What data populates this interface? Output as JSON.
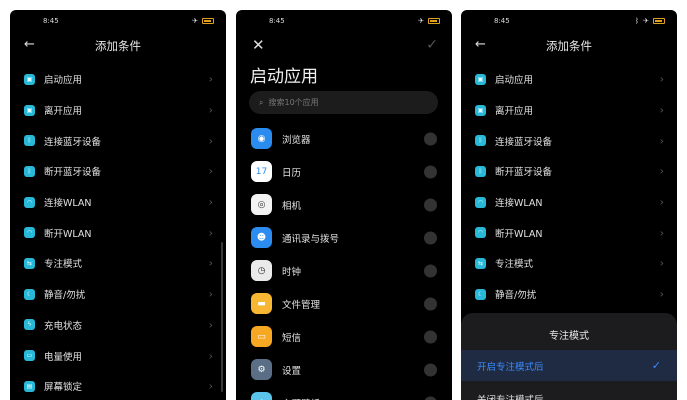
{
  "status": {
    "time": "8:45",
    "airplane": "✈"
  },
  "panel1": {
    "back": "←",
    "title": "添加条件",
    "items": [
      {
        "label": "启动应用",
        "icon": "app-launch-icon",
        "glyph": "▣"
      },
      {
        "label": "离开应用",
        "icon": "app-leave-icon",
        "glyph": "▣"
      },
      {
        "label": "连接蓝牙设备",
        "icon": "bluetooth-connect-icon",
        "glyph": "ᛒ"
      },
      {
        "label": "断开蓝牙设备",
        "icon": "bluetooth-disconnect-icon",
        "glyph": "ᛒ"
      },
      {
        "label": "连接WLAN",
        "icon": "wlan-connect-icon",
        "glyph": "◠"
      },
      {
        "label": "断开WLAN",
        "icon": "wlan-disconnect-icon",
        "glyph": "◠"
      },
      {
        "label": "专注模式",
        "icon": "focus-mode-icon",
        "glyph": "⇆"
      },
      {
        "label": "静音/勿扰",
        "icon": "silent-icon",
        "glyph": "☾"
      },
      {
        "label": "充电状态",
        "icon": "charging-icon",
        "glyph": "ϟ"
      },
      {
        "label": "电量使用",
        "icon": "battery-usage-icon",
        "glyph": "▭"
      },
      {
        "label": "屏幕锁定",
        "icon": "screen-lock-icon",
        "glyph": "▤"
      }
    ]
  },
  "panel2": {
    "close": "✕",
    "confirm": "✓",
    "title": "启动应用",
    "search_placeholder": "搜索10个应用",
    "apps": [
      {
        "label": "浏览器",
        "icon": "browser-icon",
        "color": "#2b8cf0",
        "glyph": "◉"
      },
      {
        "label": "日历",
        "icon": "calendar-icon",
        "color": "#ffffff",
        "glyph": "17"
      },
      {
        "label": "相机",
        "icon": "camera-icon",
        "color": "#f2f2f2",
        "glyph": "◎"
      },
      {
        "label": "通讯录与拨号",
        "icon": "contacts-icon",
        "color": "#2d8cf0",
        "glyph": "☻"
      },
      {
        "label": "时钟",
        "icon": "clock-icon",
        "color": "#eaeaea",
        "glyph": "◷"
      },
      {
        "label": "文件管理",
        "icon": "file-manager-icon",
        "color": "#f7b733",
        "glyph": "▬"
      },
      {
        "label": "短信",
        "icon": "messages-icon",
        "color": "#f7a823",
        "glyph": "▭"
      },
      {
        "label": "设置",
        "icon": "settings-icon",
        "color": "#5a6f86",
        "glyph": "⚙"
      },
      {
        "label": "主题壁纸",
        "icon": "theme-icon",
        "color": "#5bc4ea",
        "glyph": "◆"
      }
    ]
  },
  "panel3": {
    "back": "←",
    "title": "添加条件",
    "items": [
      {
        "label": "启动应用",
        "icon": "app-launch-icon",
        "glyph": "▣"
      },
      {
        "label": "离开应用",
        "icon": "app-leave-icon",
        "glyph": "▣"
      },
      {
        "label": "连接蓝牙设备",
        "icon": "bluetooth-connect-icon",
        "glyph": "ᛒ"
      },
      {
        "label": "断开蓝牙设备",
        "icon": "bluetooth-disconnect-icon",
        "glyph": "ᛒ"
      },
      {
        "label": "连接WLAN",
        "icon": "wlan-connect-icon",
        "glyph": "◠"
      },
      {
        "label": "断开WLAN",
        "icon": "wlan-disconnect-icon",
        "glyph": "◠"
      },
      {
        "label": "专注模式",
        "icon": "focus-mode-icon",
        "glyph": "⇆"
      },
      {
        "label": "静音/勿扰",
        "icon": "silent-icon",
        "glyph": "☾"
      }
    ],
    "sheet": {
      "title": "专注模式",
      "options": [
        {
          "label": "开启专注模式后",
          "selected": true
        },
        {
          "label": "关闭专注模式后",
          "selected": false
        }
      ]
    }
  },
  "colors": {
    "accent": "#3d8bff",
    "icon_bg": "#29b9d8",
    "background": "#000000"
  }
}
